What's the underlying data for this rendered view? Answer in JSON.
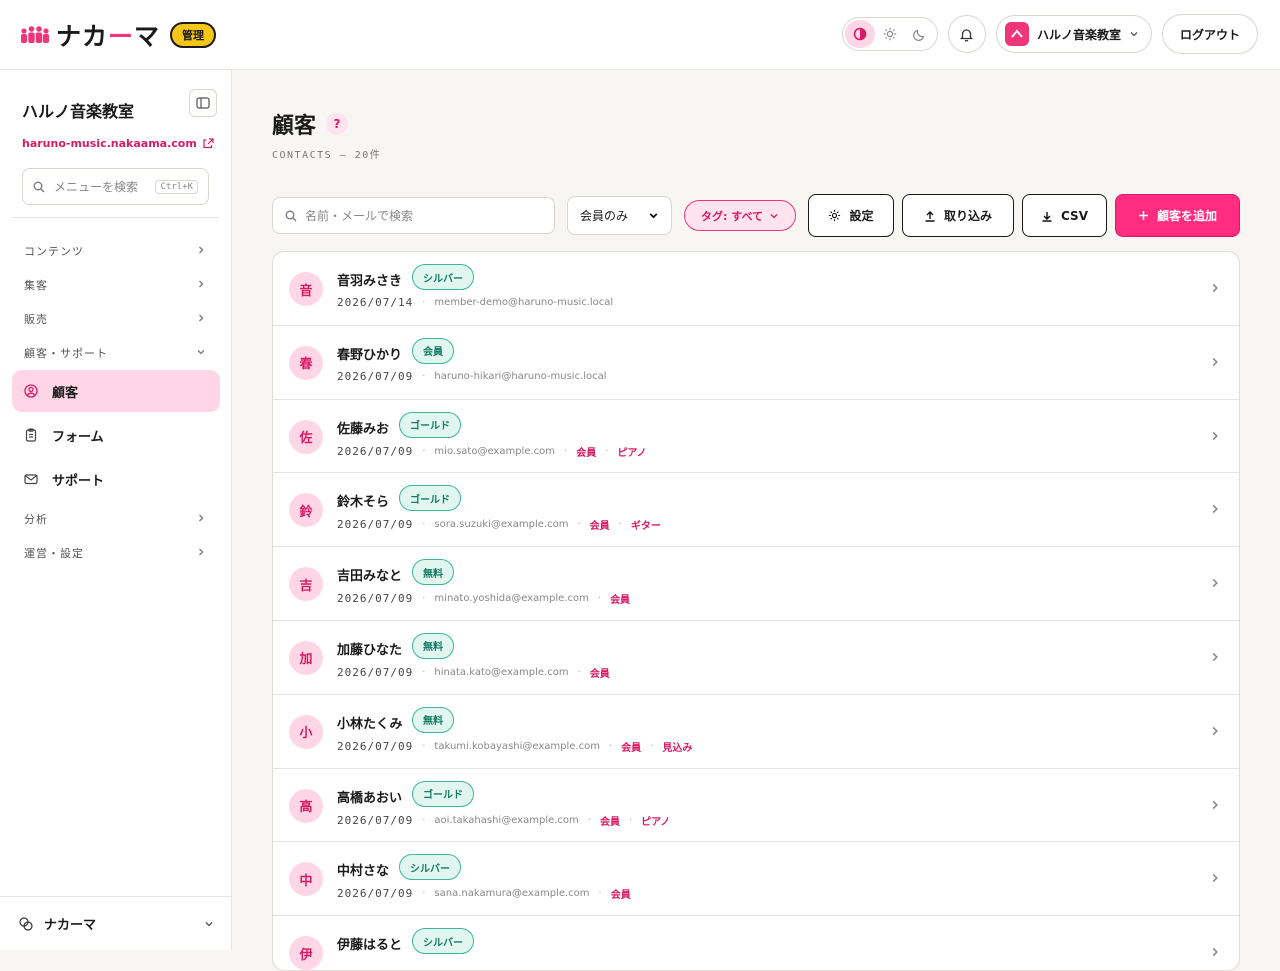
{
  "brand": {
    "logo_main": "ナカ",
    "logo_accent": "ー",
    "logo_end": "マ",
    "admin_badge": "管理",
    "accent_color": "#f0357a"
  },
  "topbar": {
    "tenant_initial": "ハ",
    "tenant_name": "ハルノ音楽教室",
    "logout": "ログアウト"
  },
  "sidebar": {
    "title": "ハルノ音楽教室",
    "url": "haruno-music.nakaama.com",
    "search_placeholder": "メニューを検索",
    "search_shortcut": "Ctrl+K",
    "groups": {
      "contents": "コンテンツ",
      "marketing": "集客",
      "sales": "販売",
      "crm": "顧客・サポート",
      "analytics": "分析",
      "operations": "運営・設定"
    },
    "items": {
      "contacts": "顧客",
      "forms": "フォーム",
      "support": "サポート"
    },
    "footer": "ナカーマ"
  },
  "page": {
    "title": "顧客",
    "help": "?",
    "subtitle": "CONTACTS — 20件"
  },
  "toolbar": {
    "search_placeholder": "名前・メールで検索",
    "filter_value": "会員のみ",
    "tag_filter": "タグ: すべて",
    "settings": "設定",
    "import": "取り込み",
    "csv": "CSV",
    "add": "顧客を追加"
  },
  "contacts": [
    {
      "initial": "音",
      "name": "音羽みさき",
      "plan": "シルバー",
      "date": "2026/07/14",
      "email": "member-demo@haruno-music.local",
      "tags": []
    },
    {
      "initial": "春",
      "name": "春野ひかり",
      "plan": "会員",
      "date": "2026/07/09",
      "email": "haruno-hikari@haruno-music.local",
      "tags": []
    },
    {
      "initial": "佐",
      "name": "佐藤みお",
      "plan": "ゴールド",
      "date": "2026/07/09",
      "email": "mio.sato@example.com",
      "tags": [
        "会員",
        "ピアノ"
      ]
    },
    {
      "initial": "鈴",
      "name": "鈴木そら",
      "plan": "ゴールド",
      "date": "2026/07/09",
      "email": "sora.suzuki@example.com",
      "tags": [
        "会員",
        "ギター"
      ]
    },
    {
      "initial": "吉",
      "name": "吉田みなと",
      "plan": "無料",
      "date": "2026/07/09",
      "email": "minato.yoshida@example.com",
      "tags": [
        "会員"
      ]
    },
    {
      "initial": "加",
      "name": "加藤ひなた",
      "plan": "無料",
      "date": "2026/07/09",
      "email": "hinata.kato@example.com",
      "tags": [
        "会員"
      ]
    },
    {
      "initial": "小",
      "name": "小林たくみ",
      "plan": "無料",
      "date": "2026/07/09",
      "email": "takumi.kobayashi@example.com",
      "tags": [
        "会員",
        "見込み"
      ]
    },
    {
      "initial": "高",
      "name": "高橋あおい",
      "plan": "ゴールド",
      "date": "2026/07/09",
      "email": "aoi.takahashi@example.com",
      "tags": [
        "会員",
        "ピアノ"
      ]
    },
    {
      "initial": "中",
      "name": "中村さな",
      "plan": "シルバー",
      "date": "2026/07/09",
      "email": "sana.nakamura@example.com",
      "tags": [
        "会員"
      ]
    },
    {
      "initial": "伊",
      "name": "伊藤はると",
      "plan": "シルバー",
      "date": "",
      "email": "",
      "tags": []
    }
  ]
}
